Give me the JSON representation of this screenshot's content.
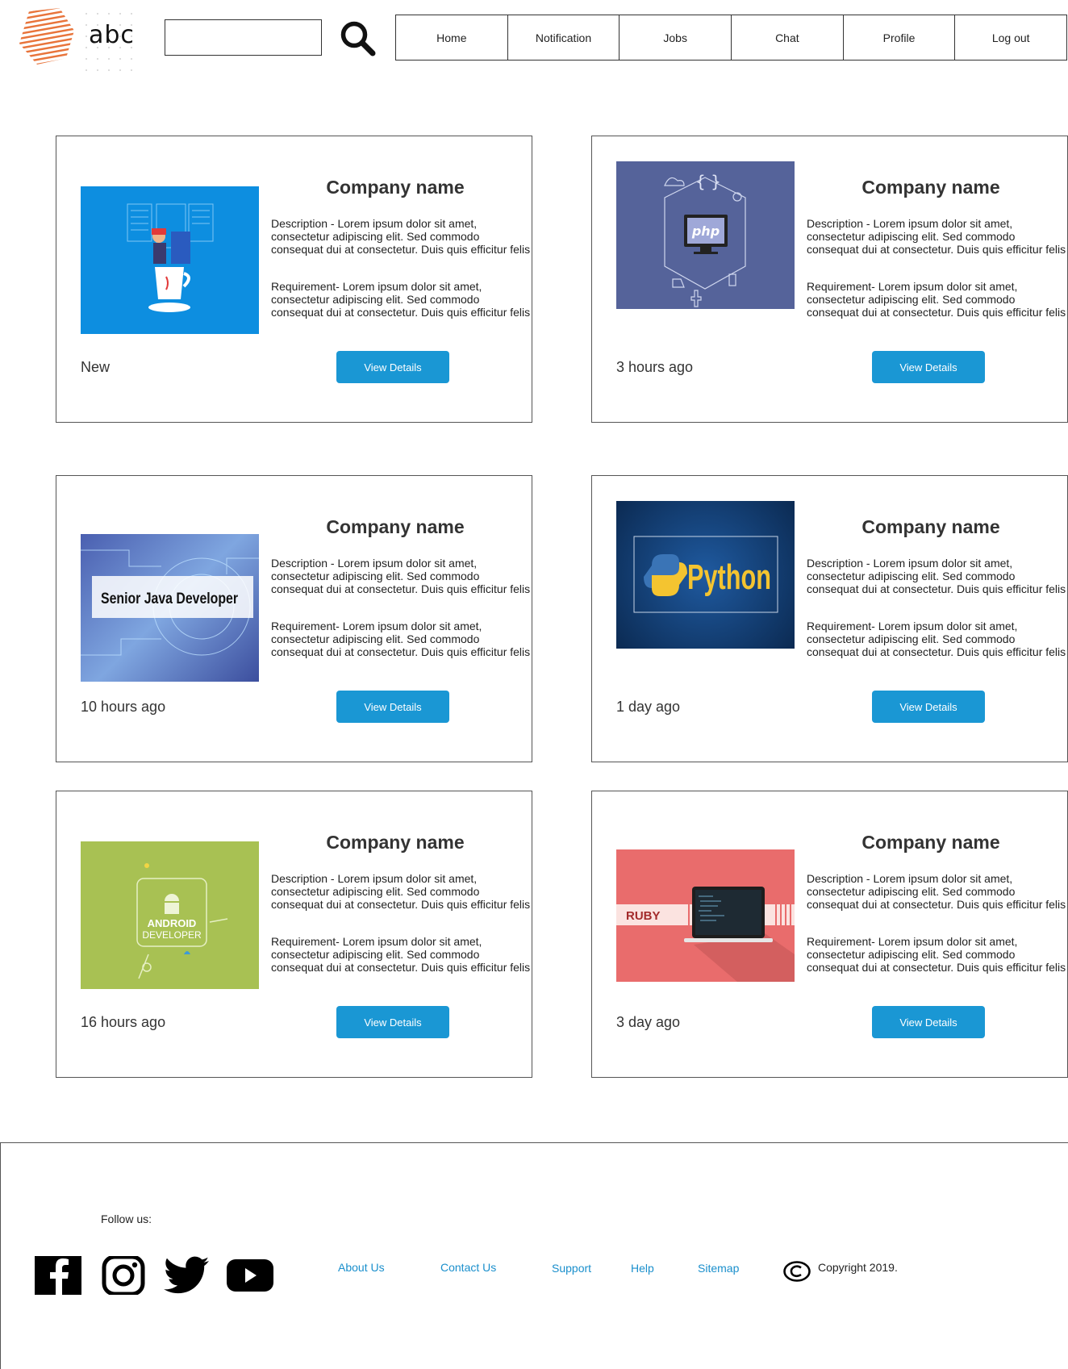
{
  "header": {
    "logo_text": "abc",
    "search_placeholder": "",
    "nav": [
      "Home",
      "Notification",
      "Jobs",
      "Chat",
      "Profile",
      "Log out"
    ]
  },
  "jobs": [
    {
      "company": "Company name",
      "description": "Description - Lorem ipsum dolor sit amet,\nconsectetur adipiscing elit. Sed commodo\nconsequat dui at consectetur. Duis quis efficitur felis",
      "requirement": "Requirement- Lorem ipsum dolor sit amet,\nconsectetur adipiscing elit. Sed commodo\nconsequat dui at consectetur. Duis quis efficitur felis",
      "time": "New",
      "button": "View Details",
      "image": "java-coffee-illustration"
    },
    {
      "company": "Company name",
      "description": "Description - Lorem ipsum dolor sit amet,\nconsectetur adipiscing elit. Sed commodo\nconsequat dui at consectetur. Duis quis efficitur felis",
      "requirement": "Requirement- Lorem ipsum dolor sit amet,\nconsectetur adipiscing elit. Sed commodo\nconsequat dui at consectetur. Duis quis efficitur felis",
      "time": "3 hours ago",
      "button": "View Details",
      "image": "php-monitor-illustration",
      "image_text": "php"
    },
    {
      "company": "Company name",
      "description": "Description - Lorem ipsum dolor sit amet,\nconsectetur adipiscing elit. Sed commodo\nconsequat dui at consectetur. Duis quis efficitur felis",
      "requirement": "Requirement- Lorem ipsum dolor sit amet,\nconsectetur adipiscing elit. Sed commodo\nconsequat dui at consectetur. Duis quis efficitur felis",
      "time": "10 hours ago",
      "button": "View Details",
      "image": "senior-java-developer-banner",
      "image_text": "Senior Java Developer"
    },
    {
      "company": "Company name",
      "description": "Description - Lorem ipsum dolor sit amet,\nconsectetur adipiscing elit. Sed commodo\nconsequat dui at consectetur. Duis quis efficitur felis",
      "requirement": "Requirement- Lorem ipsum dolor sit amet,\nconsectetur adipiscing elit. Sed commodo\nconsequat dui at consectetur. Duis quis efficitur felis",
      "time": "1 day ago",
      "button": "View Details",
      "image": "python-banner",
      "image_text": "Python"
    },
    {
      "company": "Company name",
      "description": "Description - Lorem ipsum dolor sit amet,\nconsectetur adipiscing elit. Sed commodo\nconsequat dui at consectetur. Duis quis efficitur felis",
      "requirement": "Requirement- Lorem ipsum dolor sit amet,\nconsectetur adipiscing elit. Sed commodo\nconsequat dui at consectetur. Duis quis efficitur felis",
      "time": "16 hours ago",
      "button": "View Details",
      "image": "android-developer-illustration",
      "image_text": "ANDROID",
      "image_text2": "DEVELOPER"
    },
    {
      "company": "Company name",
      "description": "Description - Lorem ipsum dolor sit amet,\nconsectetur adipiscing elit. Sed commodo\nconsequat dui at consectetur. Duis quis efficitur felis",
      "requirement": "Requirement- Lorem ipsum dolor sit amet,\nconsectetur adipiscing elit. Sed commodo\nconsequat dui at consectetur. Duis quis efficitur felis",
      "time": "3 day ago",
      "button": "View Details",
      "image": "ruby-laptop-illustration",
      "image_text": "RUBY"
    }
  ],
  "footer": {
    "follow_label": "Follow us:",
    "social": [
      "facebook-icon",
      "instagram-icon",
      "twitter-icon",
      "youtube-icon"
    ],
    "links": [
      "About Us",
      "Contact Us",
      "Support",
      "Help",
      "Sitemap"
    ],
    "copyright": "Copyright 2019."
  },
  "colors": {
    "accent": "#1a97d4",
    "link": "#1a8fcc",
    "logo": "#e8743b"
  }
}
